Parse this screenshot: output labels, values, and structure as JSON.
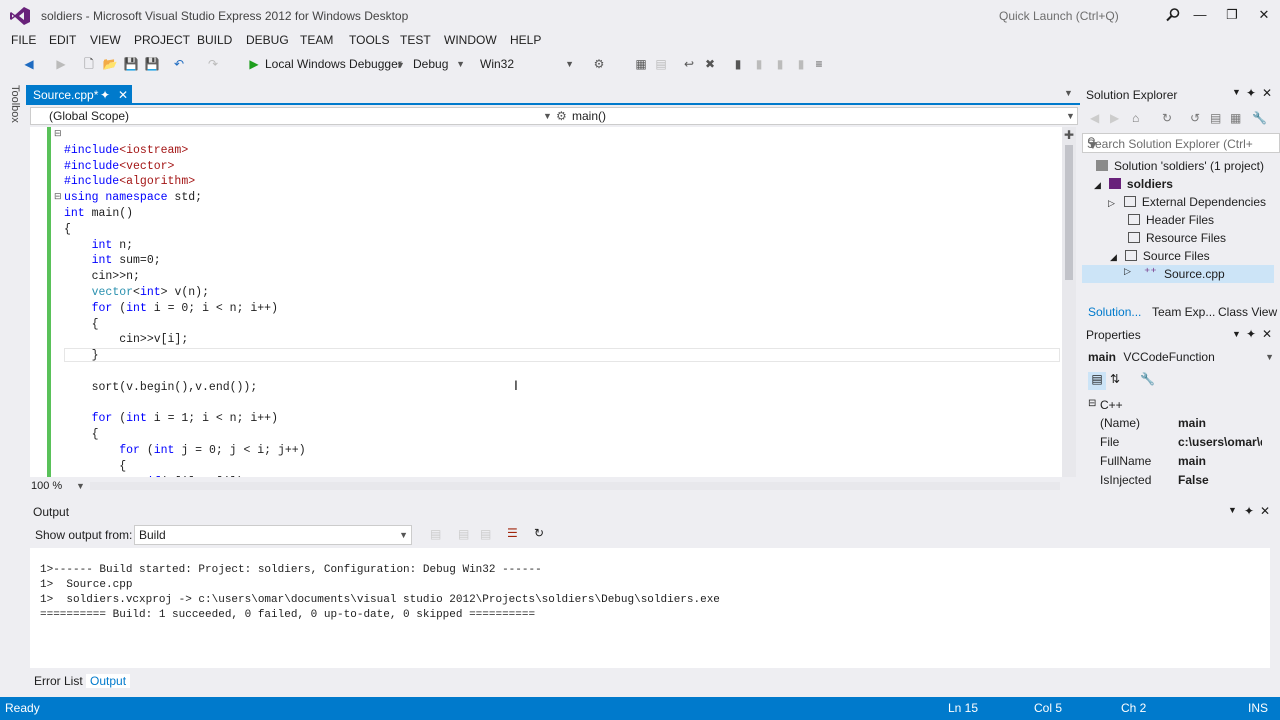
{
  "window": {
    "title": "soldiers - Microsoft Visual Studio Express 2012 for Windows Desktop",
    "quick_launch_placeholder": "Quick Launch (Ctrl+Q)"
  },
  "menu": [
    "FILE",
    "EDIT",
    "VIEW",
    "PROJECT",
    "BUILD",
    "DEBUG",
    "TEAM",
    "TOOLS",
    "TEST",
    "WINDOW",
    "HELP"
  ],
  "toolbar": {
    "debugger_label": "Local Windows Debugger",
    "config": "Debug",
    "platform": "Win32"
  },
  "toolbox_label": "Toolbox",
  "editor": {
    "tab_label": "Source.cpp*",
    "scope": "(Global Scope)",
    "function": "main()",
    "zoom": "100 %",
    "lines": [
      "#include<iostream>",
      "#include<vector>",
      "#include<algorithm>",
      "using namespace std;",
      "int main()",
      "{",
      "    int n;",
      "    int sum=0;",
      "    cin>>n;",
      "    vector<int> v(n);",
      "    for (int i = 0; i < n; i++)",
      "    {",
      "        cin>>v[i];",
      "    }",
      "",
      "    sort(v.begin(),v.end());",
      "",
      "    for (int i = 1; i < n; i++)",
      "    {",
      "        for (int j = 0; j < i; j++)",
      "        {",
      "            if(v[i]==v[j])"
    ]
  },
  "solution_explorer": {
    "title": "Solution Explorer",
    "search_placeholder": "Search Solution Explorer (Ctrl+;)",
    "items": [
      {
        "label": "Solution 'soldiers' (1 project)"
      },
      {
        "label": "soldiers"
      },
      {
        "label": "External Dependencies"
      },
      {
        "label": "Header Files"
      },
      {
        "label": "Resource Files"
      },
      {
        "label": "Source Files"
      },
      {
        "label": "Source.cpp"
      }
    ],
    "tabs": [
      "Solution...",
      "Team Exp...",
      "Class View"
    ]
  },
  "properties": {
    "title": "Properties",
    "object": "main",
    "object_type": "VCCodeFunction",
    "category": "C++",
    "rows": [
      {
        "key": "(Name)",
        "value": "main"
      },
      {
        "key": "File",
        "value": "c:\\users\\omar\\documents"
      },
      {
        "key": "FullName",
        "value": "main"
      },
      {
        "key": "IsInjected",
        "value": "False"
      }
    ]
  },
  "output": {
    "title": "Output",
    "show_from_label": "Show output from:",
    "source": "Build",
    "lines": [
      "1>------ Build started: Project: soldiers, Configuration: Debug Win32 ------",
      "1>  Source.cpp",
      "1>  soldiers.vcxproj -> c:\\users\\omar\\documents\\visual studio 2012\\Projects\\soldiers\\Debug\\soldiers.exe",
      "========== Build: 1 succeeded, 0 failed, 0 up-to-date, 0 skipped =========="
    ]
  },
  "bottom_tabs": [
    "Error List",
    "Output"
  ],
  "status": {
    "state": "Ready",
    "ln": "Ln 15",
    "col": "Col 5",
    "ch": "Ch 2",
    "mode": "INS"
  },
  "colors": {
    "accent": "#007acc",
    "keyword": "#0000ff",
    "string": "#a31515",
    "type": "#2b91af",
    "changed_margin": "#59c159"
  }
}
